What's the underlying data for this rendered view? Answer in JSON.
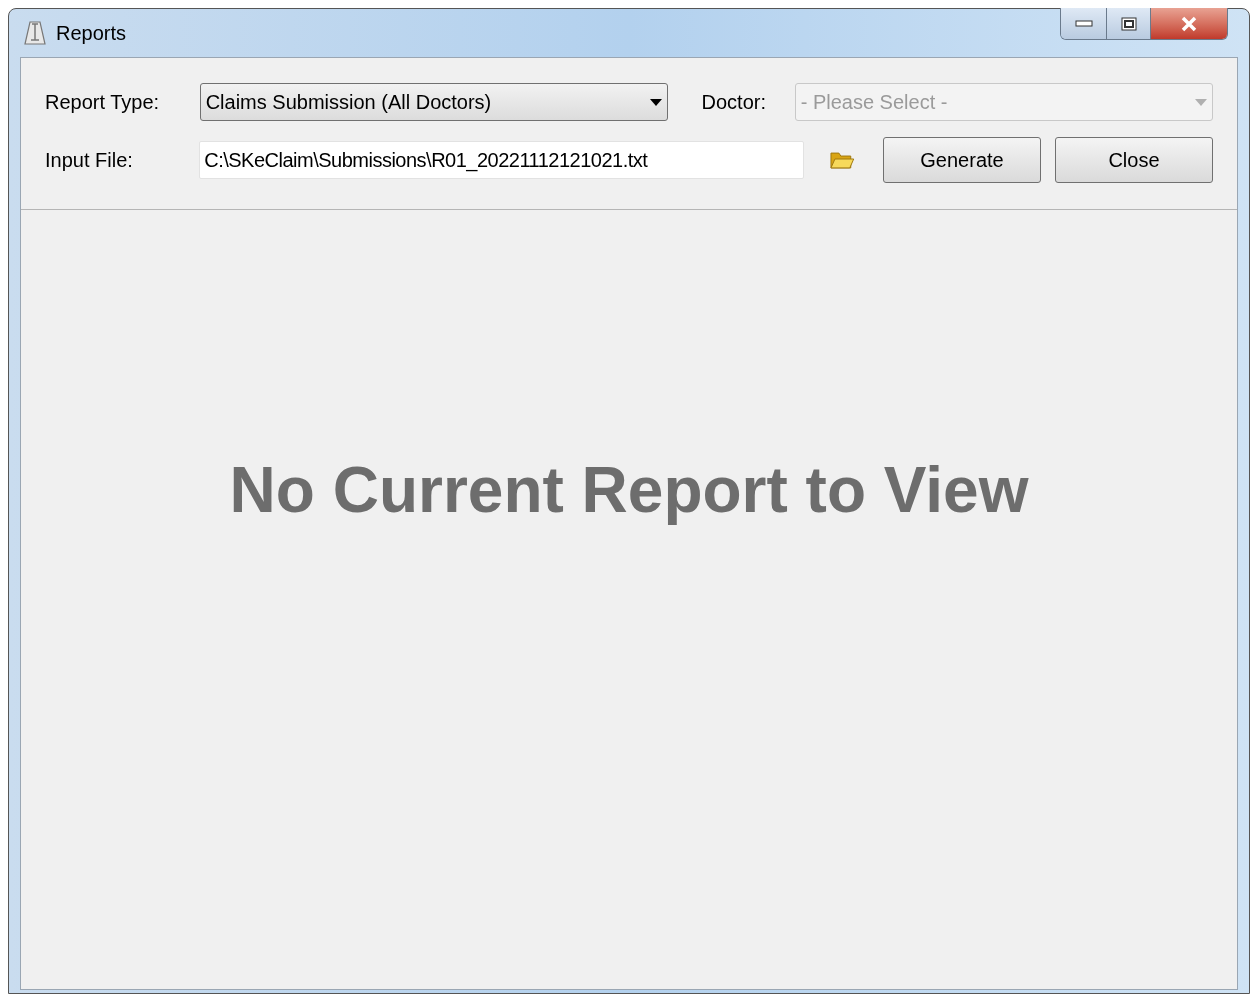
{
  "window": {
    "title": "Reports"
  },
  "report_type": {
    "label": "Report Type:",
    "value": "Claims Submission (All Doctors)",
    "disabled": false
  },
  "doctor": {
    "label": "Doctor:",
    "value": "- Please Select -",
    "disabled": true
  },
  "input_file": {
    "label": "Input File:",
    "value": "C:\\SKeClaim\\Submissions\\R01_20221112121021.txt"
  },
  "buttons": [
    {
      "label": "Generate"
    },
    {
      "label": "Close"
    }
  ],
  "viewer": {
    "message": "No Current Report to View"
  }
}
